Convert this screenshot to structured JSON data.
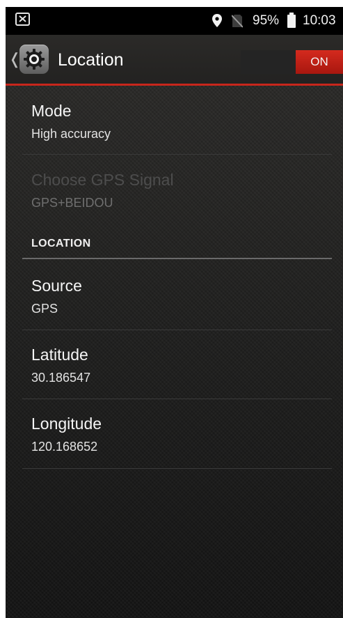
{
  "status_bar": {
    "battery_percent": "95%",
    "time": "10:03",
    "icons": [
      "screenshot-icon",
      "location-pin-icon",
      "no-sim-icon",
      "battery-icon"
    ]
  },
  "action_bar": {
    "title": "Location",
    "toggle_label": "ON",
    "app_icon": "settings-gear-icon"
  },
  "prefs": {
    "mode": {
      "title": "Mode",
      "summary": "High accuracy"
    },
    "gps_signal": {
      "title": "Choose GPS Signal",
      "summary": "GPS+BEIDOU"
    }
  },
  "category": {
    "label": "LOCATION"
  },
  "location": {
    "source": {
      "title": "Source",
      "value": "GPS"
    },
    "latitude": {
      "title": "Latitude",
      "value": "30.186547"
    },
    "longitude": {
      "title": "Longitude",
      "value": "120.168652"
    }
  },
  "colors": {
    "accent": "#c8261c",
    "background": "#262523"
  }
}
